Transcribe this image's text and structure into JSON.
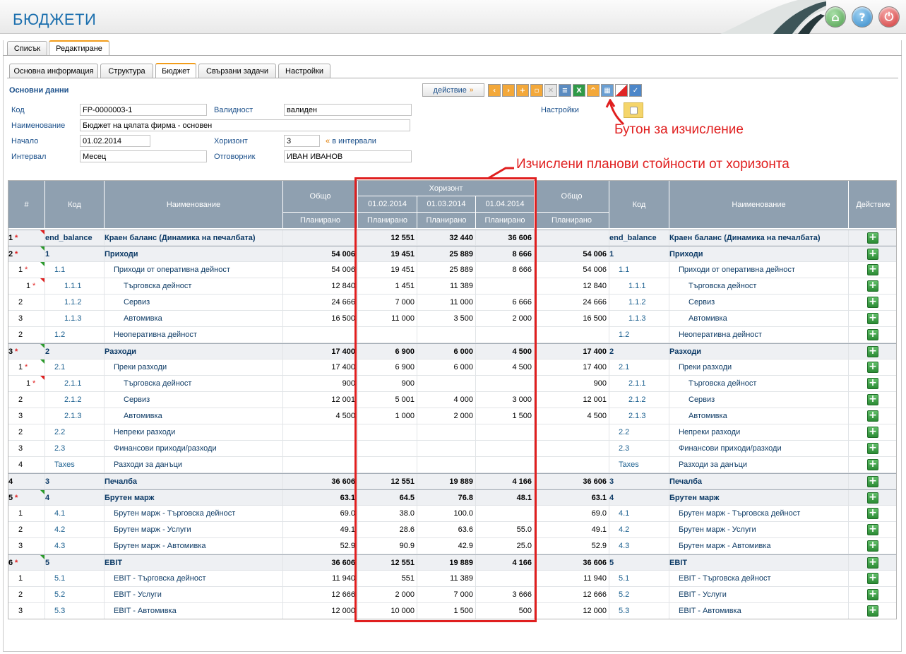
{
  "app": {
    "title": "БЮДЖЕТИ"
  },
  "header_icons": [
    "home-icon",
    "help-icon",
    "power-icon"
  ],
  "tabs_top": [
    {
      "label": "Списък",
      "active": false
    },
    {
      "label": "Редактиране",
      "active": true
    }
  ],
  "tabs_sub": [
    {
      "label": "Основна информация",
      "active": false
    },
    {
      "label": "Структура",
      "active": false
    },
    {
      "label": "Бюджет",
      "active": true
    },
    {
      "label": "Свързани задачи",
      "active": false
    },
    {
      "label": "Настройки",
      "active": false
    }
  ],
  "section_title": "Основни данни",
  "toolbar": {
    "action_label": "действие",
    "action_arrow": "»",
    "buttons": [
      "prev-icon",
      "next-icon",
      "add-icon",
      "copy-icon",
      "delete-icon",
      "print-icon",
      "excel-icon",
      "up-icon",
      "calculate-icon",
      "clear-icon",
      "confirm-icon"
    ]
  },
  "form": {
    "code_label": "Код",
    "code_value": "FP-0000003-1",
    "validity_label": "Валидност",
    "validity_value": "валиден",
    "settings_label": "Настройки",
    "name_label": "Наименование",
    "name_value": "Бюджет на цялата фирма - основен",
    "start_label": "Начало",
    "start_value": "01.02.2014",
    "horizon_label": "Хоризонт",
    "horizon_value": "3",
    "horizon_suffix": "в интервали",
    "horizon_suffix_mark": "«",
    "interval_label": "Интервал",
    "interval_value": "Месец",
    "owner_label": "Отговорник",
    "owner_value": "ИВАН ИВАНОВ"
  },
  "annotations": {
    "calc_button": "Бутон за изчисление",
    "horizon_values": "Изчислени планови стойности от хоризонта"
  },
  "table": {
    "headers": {
      "num": "#",
      "code": "Код",
      "name": "Наименование",
      "total": "Общо",
      "horizon": "Хоризонт",
      "dates": [
        "01.02.2014",
        "01.03.2014",
        "01.04.2014"
      ],
      "planned": "Планирано",
      "action": "Действие"
    },
    "rows": [
      {
        "num": "1",
        "star": true,
        "tri": "red",
        "lvl": 0,
        "code": "end_balance",
        "name": "Краен баланс (Динамика на печалбата)",
        "bold": true,
        "total": "",
        "h1": "12 551",
        "h2": "32 440",
        "h3": "36 606",
        "total2": ""
      },
      {
        "num": "2",
        "star": true,
        "tri": "green",
        "lvl": 0,
        "code": "1",
        "name": "Приходи",
        "bold": true,
        "total": "54 006",
        "h1": "19 451",
        "h2": "25 889",
        "h3": "8 666",
        "total2": "54 006"
      },
      {
        "num": "1",
        "star": true,
        "tri": "green",
        "lvl": 1,
        "code": "1.1",
        "name": "Приходи от оперативна дейност",
        "bold": false,
        "total": "54 006",
        "h1": "19 451",
        "h2": "25 889",
        "h3": "8 666",
        "total2": "54 006"
      },
      {
        "num": "1",
        "star": true,
        "tri": "red",
        "lvl": 2,
        "code": "1.1.1",
        "name": "Търговска дейност",
        "bold": false,
        "total": "12 840",
        "h1": "1 451",
        "h2": "11 389",
        "h3": "",
        "total2": "12 840"
      },
      {
        "num": "2",
        "star": false,
        "tri": "",
        "lvl": 2,
        "code": "1.1.2",
        "name": "Сервиз",
        "bold": false,
        "total": "24 666",
        "h1": "7 000",
        "h2": "11 000",
        "h3": "6 666",
        "total2": "24 666"
      },
      {
        "num": "3",
        "star": false,
        "tri": "",
        "lvl": 2,
        "code": "1.1.3",
        "name": "Автомивка",
        "bold": false,
        "total": "16 500",
        "h1": "11 000",
        "h2": "3 500",
        "h3": "2 000",
        "total2": "16 500"
      },
      {
        "num": "2",
        "star": false,
        "tri": "",
        "lvl": 1,
        "code": "1.2",
        "name": "Неоперативна дейност",
        "bold": false,
        "total": "",
        "h1": "",
        "h2": "",
        "h3": "",
        "total2": ""
      },
      {
        "num": "3",
        "star": true,
        "tri": "green",
        "lvl": 0,
        "code": "2",
        "name": "Разходи",
        "bold": true,
        "total": "17 400",
        "h1": "6 900",
        "h2": "6 000",
        "h3": "4 500",
        "total2": "17 400"
      },
      {
        "num": "1",
        "star": true,
        "tri": "green",
        "lvl": 1,
        "code": "2.1",
        "name": "Преки разходи",
        "bold": false,
        "total": "17 400",
        "h1": "6 900",
        "h2": "6 000",
        "h3": "4 500",
        "total2": "17 400"
      },
      {
        "num": "1",
        "star": true,
        "tri": "red",
        "lvl": 2,
        "code": "2.1.1",
        "name": "Търговска дейност",
        "bold": false,
        "total": "900",
        "h1": "900",
        "h2": "",
        "h3": "",
        "total2": "900"
      },
      {
        "num": "2",
        "star": false,
        "tri": "",
        "lvl": 2,
        "code": "2.1.2",
        "name": "Сервиз",
        "bold": false,
        "total": "12 001",
        "h1": "5 001",
        "h2": "4 000",
        "h3": "3 000",
        "total2": "12 001"
      },
      {
        "num": "3",
        "star": false,
        "tri": "",
        "lvl": 2,
        "code": "2.1.3",
        "name": "Автомивка",
        "bold": false,
        "total": "4 500",
        "h1": "1 000",
        "h2": "2 000",
        "h3": "1 500",
        "total2": "4 500"
      },
      {
        "num": "2",
        "star": false,
        "tri": "",
        "lvl": 1,
        "code": "2.2",
        "name": "Непреки разходи",
        "bold": false,
        "total": "",
        "h1": "",
        "h2": "",
        "h3": "",
        "total2": ""
      },
      {
        "num": "3",
        "star": false,
        "tri": "",
        "lvl": 1,
        "code": "2.3",
        "name": "Финансови приходи/разходи",
        "bold": false,
        "total": "",
        "h1": "",
        "h2": "",
        "h3": "",
        "total2": ""
      },
      {
        "num": "4",
        "star": false,
        "tri": "",
        "lvl": 1,
        "code": "Taxes",
        "name": "Разходи за данъци",
        "bold": false,
        "total": "",
        "h1": "",
        "h2": "",
        "h3": "",
        "total2": ""
      },
      {
        "num": "4",
        "star": false,
        "tri": "",
        "lvl": 0,
        "code": "3",
        "name": "Печалба",
        "bold": true,
        "total": "36 606",
        "h1": "12 551",
        "h2": "19 889",
        "h3": "4 166",
        "total2": "36 606"
      },
      {
        "num": "5",
        "star": true,
        "tri": "green",
        "lvl": 0,
        "code": "4",
        "name": "Брутен марж",
        "bold": true,
        "total": "63.1",
        "h1": "64.5",
        "h2": "76.8",
        "h3": "48.1",
        "total2": "63.1"
      },
      {
        "num": "1",
        "star": false,
        "tri": "",
        "lvl": 1,
        "code": "4.1",
        "name": "Брутен марж - Търговска дейност",
        "bold": false,
        "total": "69.0",
        "h1": "38.0",
        "h2": "100.0",
        "h3": "",
        "total2": "69.0"
      },
      {
        "num": "2",
        "star": false,
        "tri": "",
        "lvl": 1,
        "code": "4.2",
        "name": "Брутен марж - Услуги",
        "bold": false,
        "total": "49.1",
        "h1": "28.6",
        "h2": "63.6",
        "h3": "55.0",
        "total2": "49.1"
      },
      {
        "num": "3",
        "star": false,
        "tri": "",
        "lvl": 1,
        "code": "4.3",
        "name": "Брутен марж - Автомивка",
        "bold": false,
        "total": "52.9",
        "h1": "90.9",
        "h2": "42.9",
        "h3": "25.0",
        "total2": "52.9"
      },
      {
        "num": "6",
        "star": true,
        "tri": "green",
        "lvl": 0,
        "code": "5",
        "name": "EBIT",
        "bold": true,
        "total": "36 606",
        "h1": "12 551",
        "h2": "19 889",
        "h3": "4 166",
        "total2": "36 606"
      },
      {
        "num": "1",
        "star": false,
        "tri": "",
        "lvl": 1,
        "code": "5.1",
        "name": "EBIT - Търговска дейност",
        "bold": false,
        "total": "11 940",
        "h1": "551",
        "h2": "11 389",
        "h3": "",
        "total2": "11 940"
      },
      {
        "num": "2",
        "star": false,
        "tri": "",
        "lvl": 1,
        "code": "5.2",
        "name": "EBIT - Услуги",
        "bold": false,
        "total": "12 666",
        "h1": "2 000",
        "h2": "7 000",
        "h3": "3 666",
        "total2": "12 666"
      },
      {
        "num": "3",
        "star": false,
        "tri": "",
        "lvl": 1,
        "code": "5.3",
        "name": "EBIT - Автомивка",
        "bold": false,
        "total": "12 000",
        "h1": "10 000",
        "h2": "1 500",
        "h3": "500",
        "total2": "12 000"
      }
    ]
  },
  "colors": {
    "accent": "#1b6fae",
    "annotation": "#e01f1f",
    "header_bg": "#8fa0b0",
    "tab_active": "#f29d1a",
    "add_button": "#3a9f42"
  }
}
